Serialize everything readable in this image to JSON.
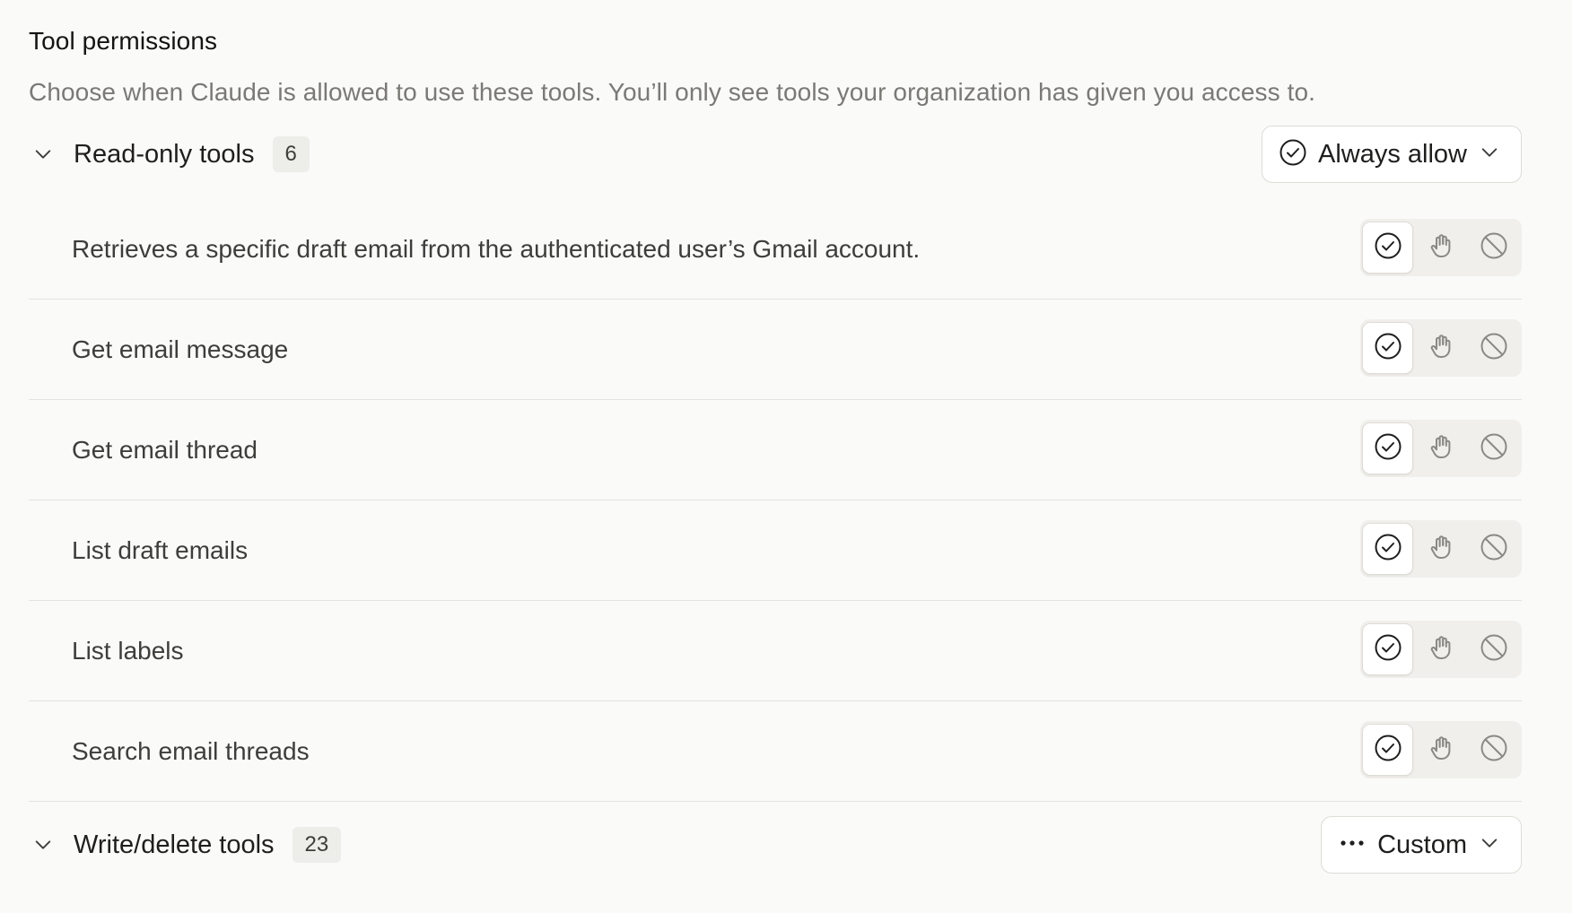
{
  "section": {
    "title": "Tool permissions",
    "description": "Choose when Claude is allowed to use these tools. You’ll only see tools your organization has given you access to."
  },
  "groups": [
    {
      "title": "Read-only tools",
      "count": "6",
      "policy_label": "Always allow",
      "policy_icon": "check-circle-icon",
      "expanded": true
    },
    {
      "title": "Write/delete tools",
      "count": "23",
      "policy_label": "Custom",
      "policy_icon": "more-horizontal-icon",
      "expanded": true
    }
  ],
  "read_only_tools": [
    {
      "name": "Retrieves a specific draft email from the authenticated user’s Gmail account.",
      "selected": "always-allow"
    },
    {
      "name": "Get email message",
      "selected": "always-allow"
    },
    {
      "name": "Get email thread",
      "selected": "always-allow"
    },
    {
      "name": "List draft emails",
      "selected": "always-allow"
    },
    {
      "name": "List labels",
      "selected": "always-allow"
    },
    {
      "name": "Search email threads",
      "selected": "always-allow"
    }
  ],
  "permission_options": [
    {
      "id": "always-allow",
      "icon": "check-circle-icon"
    },
    {
      "id": "needs-approval",
      "icon": "hand-icon"
    },
    {
      "id": "blocked",
      "icon": "block-icon"
    }
  ],
  "colors": {
    "background": "#fafaf9",
    "text_primary": "#1f1e1d",
    "text_muted": "#7a7975",
    "icon_inactive": "#8a8985",
    "divider": "#e5e3dd"
  }
}
